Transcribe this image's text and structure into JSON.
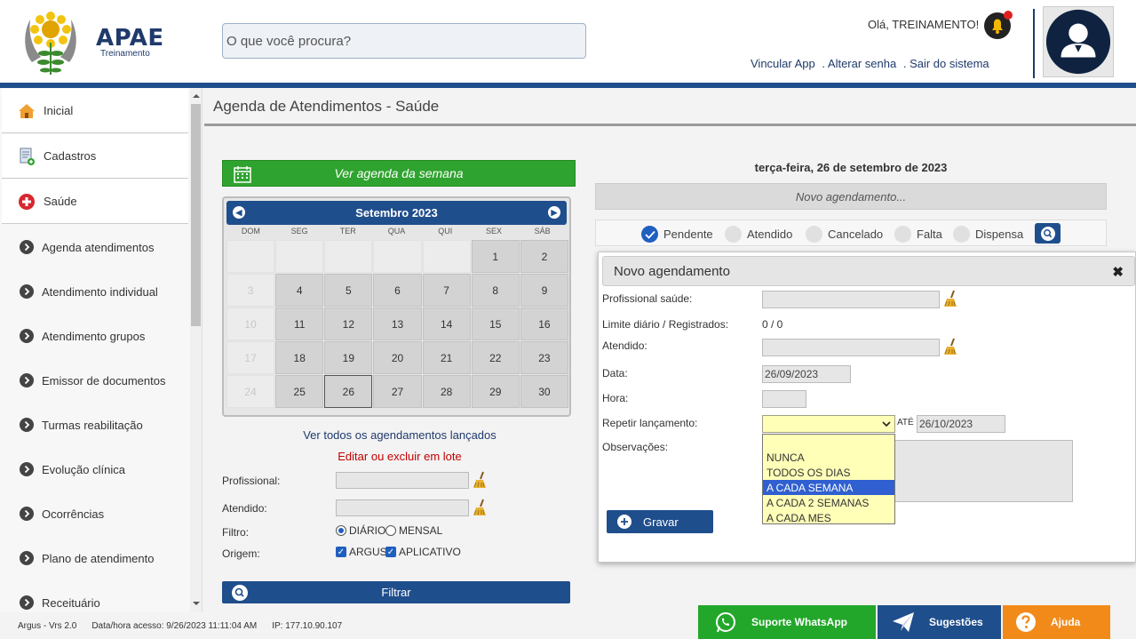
{
  "header": {
    "logo_title": "APAE",
    "logo_subtitle": "Treinamento",
    "search_placeholder": "O que você procura?",
    "greeting": "Olá, TREINAMENTO!",
    "links": [
      "Vincular App",
      ". Alterar senha",
      ". Sair do sistema"
    ]
  },
  "sidebar": {
    "items": [
      {
        "label": "Inicial",
        "icon": "home-icon"
      },
      {
        "label": "Cadastros",
        "icon": "document-add-icon"
      },
      {
        "label": "Saúde",
        "icon": "health-cross-icon"
      }
    ],
    "subitems": [
      "Agenda atendimentos",
      "Atendimento individual",
      "Atendimento grupos",
      "Emissor de documentos",
      "Turmas reabilitação",
      "Evolução clínica",
      "Ocorrências",
      "Plano de atendimento",
      "Receituário"
    ]
  },
  "main": {
    "title": "Agenda de Atendimentos - Saúde",
    "week_button": "Ver agenda da semana",
    "calendar": {
      "month": "Setembro 2023",
      "days_of_week": [
        "DOM",
        "SEG",
        "TER",
        "QUA",
        "QUI",
        "SEX",
        "SÁB"
      ],
      "weeks": [
        [
          "",
          "",
          "",
          "",
          "",
          "1",
          "2"
        ],
        [
          "3",
          "4",
          "5",
          "6",
          "7",
          "8",
          "9"
        ],
        [
          "10",
          "11",
          "12",
          "13",
          "14",
          "15",
          "16"
        ],
        [
          "17",
          "18",
          "19",
          "20",
          "21",
          "22",
          "23"
        ],
        [
          "24",
          "25",
          "26",
          "27",
          "28",
          "29",
          "30"
        ]
      ],
      "today": "26"
    },
    "see_all": "Ver todos os agendamentos lançados",
    "bulk_edit": "Editar ou excluir em lote",
    "filters": {
      "profissional_label": "Profissional:",
      "atendido_label": "Atendido:",
      "filtro_label": "Filtro:",
      "filtro_options": [
        "DIÁRIO",
        "MENSAL"
      ],
      "filtro_selected": "DIÁRIO",
      "origem_label": "Origem:",
      "origem_options": [
        "ARGUS",
        "APLICATIVO"
      ],
      "filter_button": "Filtrar"
    },
    "selected_date": "terça-feira, 26 de setembro de 2023",
    "new_appointment_bar": "Novo agendamento...",
    "statuses": [
      {
        "label": "Pendente",
        "checked": true
      },
      {
        "label": "Atendido",
        "checked": false
      },
      {
        "label": "Cancelado",
        "checked": false
      },
      {
        "label": "Falta",
        "checked": false
      },
      {
        "label": "Dispensa",
        "checked": false
      }
    ]
  },
  "modal": {
    "title": "Novo agendamento",
    "fields": {
      "profissional_label": "Profissional saúde:",
      "limite_label": "Limite diário / Registrados:",
      "limite_value": "0 / 0",
      "atendido_label": "Atendido:",
      "data_label": "Data:",
      "data_value": "26/09/2023",
      "hora_label": "Hora:",
      "repetir_label": "Repetir lançamento:",
      "ate_label": "ATÉ",
      "ate_value": "26/10/2023",
      "obs_label": "Observações:"
    },
    "repeat_options": [
      "NUNCA",
      "TODOS OS DIAS",
      "A CADA SEMANA",
      "A CADA 2 SEMANAS",
      "A CADA MES"
    ],
    "repeat_highlighted": "A CADA SEMANA",
    "save_button": "Gravar"
  },
  "footer": {
    "version": "Argus - Vrs 2.0",
    "access": "Data/hora acesso: 9/26/2023 11:11:04 AM",
    "ip": "IP: 177.10.90.107",
    "whatsapp_button": "Suporte WhatsApp",
    "suggestions_button": "Sugestões",
    "help_button": "Ajuda"
  },
  "colors": {
    "brand_blue": "#1f4e8c",
    "green": "#2fa32f",
    "whatsapp_green": "#22a72a",
    "help_orange": "#f28a1a",
    "bulk_red": "#c00000"
  }
}
